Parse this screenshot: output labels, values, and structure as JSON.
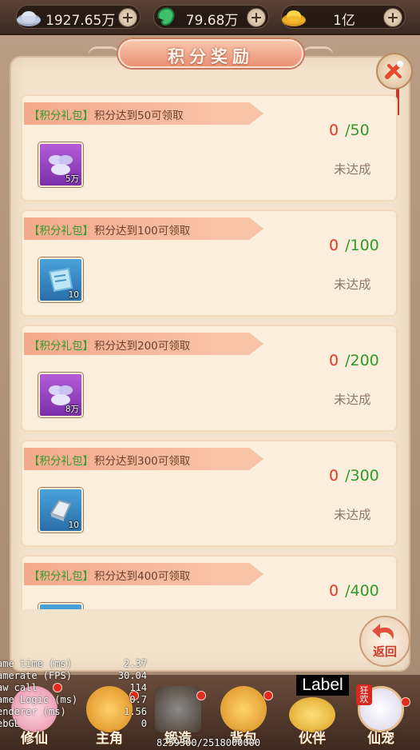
{
  "currencies": [
    {
      "name": "silver",
      "icon": "silver-ingot-icon",
      "value": "1927.65万"
    },
    {
      "name": "jade",
      "icon": "jade-icon",
      "value": "79.68万"
    },
    {
      "name": "gold",
      "icon": "gold-ingot-icon",
      "value": "1亿"
    }
  ],
  "plus_glyph": "+",
  "title": "积分奖励",
  "rewards": [
    {
      "tag": "【积分礼包】",
      "desc": "积分达到50可领取",
      "current": "0",
      "target": "/50",
      "status": "未达成",
      "item_icon": "silver-ingots-icon",
      "item_color": "purple",
      "qty": "5万"
    },
    {
      "tag": "【积分礼包】",
      "desc": "积分达到100可领取",
      "current": "0",
      "target": "/100",
      "status": "未达成",
      "item_icon": "blue-scroll-icon",
      "item_color": "blue",
      "qty": "10"
    },
    {
      "tag": "【积分礼包】",
      "desc": "积分达到200可领取",
      "current": "0",
      "target": "/200",
      "status": "未达成",
      "item_icon": "silver-ingots-icon",
      "item_color": "purple",
      "qty": "8万"
    },
    {
      "tag": "【积分礼包】",
      "desc": "积分达到300可领取",
      "current": "0",
      "target": "/300",
      "status": "未达成",
      "item_icon": "silver-bar-icon",
      "item_color": "blue",
      "qty": "10"
    },
    {
      "tag": "【积分礼包】",
      "desc": "积分达到400可领取",
      "current": "0",
      "target": "/400",
      "status": "",
      "item_icon": "blue-item-icon",
      "item_color": "blue",
      "qty": ""
    }
  ],
  "back_label": "返回",
  "debug": [
    {
      "k": "ame time (ms)",
      "v": "2.37"
    },
    {
      "k": "amerate (FPS)",
      "v": "30.04"
    },
    {
      "k": "aw call",
      "v": "114"
    },
    {
      "k": "ame Logic (ms)",
      "v": "0.7"
    },
    {
      "k": "enderer (ms)",
      "v": "1.56"
    },
    {
      "k": "ebGL",
      "v": "0"
    }
  ],
  "label_text": "Label",
  "counter_text": "8259300/2518000000",
  "nav": [
    {
      "label": "修仙",
      "icon": "cultivate-icon",
      "dot": true
    },
    {
      "label": "主角",
      "icon": "hero-icon",
      "dot": true
    },
    {
      "label": "锻造",
      "icon": "forge-icon",
      "dot": true
    },
    {
      "label": "背包",
      "icon": "bag-icon",
      "dot": true
    },
    {
      "label": "伙伴",
      "icon": "partner-icon",
      "dot": false
    },
    {
      "label": "仙宠",
      "icon": "pet-icon",
      "dot": true
    }
  ],
  "pet_badge": "狂欢",
  "colors": {
    "current_score": "#e8342a",
    "target_score": "#2f9a2b",
    "tag": "#2f9a2b",
    "status": "#8f7766"
  }
}
